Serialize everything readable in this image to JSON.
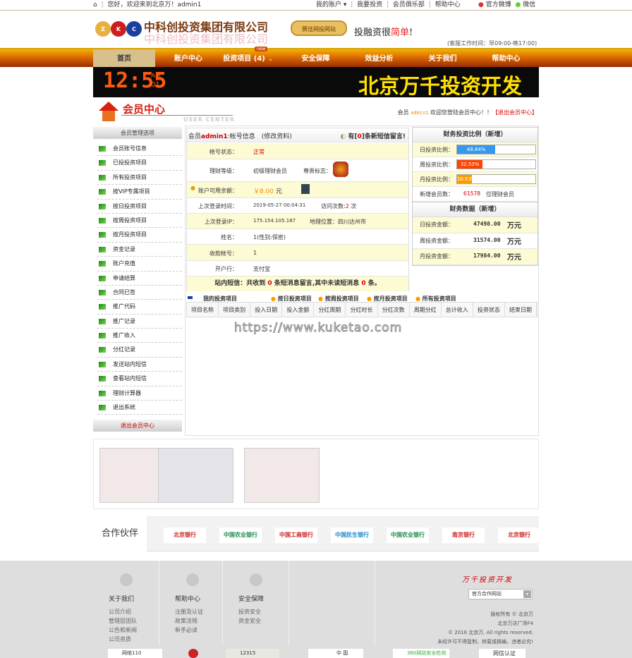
{
  "topbar": {
    "greeting": "您好，欢迎来到北京万！admin1",
    "my_account": "我的账户 ▾",
    "invest": "我要投资",
    "club": "会员俱乐部",
    "help": "帮助中心",
    "weibo": "官方微博",
    "wechat": "微信"
  },
  "header": {
    "company": "中科创投资集团有限公司",
    "badge_text": "赛佳网投网站",
    "slogan": "投融资很",
    "slogan_highlight": "简单",
    "slogan_end": "!",
    "hours": "(客服工作时间：早09:00-晚17:00)",
    "logo_letters": [
      "Z",
      "K",
      "C"
    ]
  },
  "nav": {
    "items": [
      {
        "label": "首页"
      },
      {
        "label": "账户中心"
      },
      {
        "label": "投资项目 (4)"
      },
      {
        "label": "安全保障"
      },
      {
        "label": "效益分析"
      },
      {
        "label": "关于我们"
      },
      {
        "label": "帮助中心"
      }
    ],
    "new_badge": "new"
  },
  "banner": {
    "clock": "12:55",
    "ampm": "AM",
    "sec": "01",
    "text": "北京万千投资开发"
  },
  "member_header": {
    "title": "会员中心",
    "subtitle": "USER CENTER",
    "welcome_pre": "会员",
    "username": "admin1",
    "welcome_post": "欢迎您登陆会员中心！！",
    "logout": "【退出会员中心】"
  },
  "sidebar": {
    "title": "会员管理选项",
    "items": [
      "会员账号信息",
      "已投投资项目",
      "所有投资项目",
      "按VIP专属项目",
      "按日投资项目",
      "按周投资项目",
      "按月投资项目",
      "资金记录",
      "账户充值",
      "申请结算",
      "合同已签",
      "推广代码",
      "推广记录",
      "推广收入",
      "分红记录",
      "发送站内短信",
      "查看站内短信",
      "理财计算器",
      "退出系统"
    ],
    "footer": "退出会员中心"
  },
  "account": {
    "title_pre": "会员",
    "username": "admin1",
    "title_post": ":帐号信息",
    "edit": "(修改资料)",
    "msg_pre": "有[",
    "msg_count": "0",
    "msg_post": "]条新短信留言!",
    "rows": [
      {
        "label": "帐号状态：",
        "value": "正常"
      },
      {
        "label": "理财等级：",
        "value": "初级理财会员",
        "extra_label": "尊贵标志："
      },
      {
        "label": "账户可用余额：",
        "value": "￥8.00",
        "unit": "元"
      },
      {
        "label": "上次登录时间：",
        "value": "2019-05-27 00:04:31",
        "extra_label": "访问次数:",
        "extra_value": "2",
        "extra_unit": "次"
      },
      {
        "label": "上次登录IP：",
        "value": "175.154.105.187",
        "extra_label": "地理位置：四川达州市"
      },
      {
        "label": "姓名：",
        "value": "1(性别:保密)"
      },
      {
        "label": "收款帐号：",
        "value": "1"
      },
      {
        "label": "开户行：",
        "value": "支付宝"
      }
    ],
    "summary_pre": "站内短信：共收到",
    "summary_count": "0",
    "summary_mid": "条短消息留言,其中未读短消息",
    "summary_unread": "0",
    "summary_post": "条。"
  },
  "ratio": {
    "title": "财务投资比例（新增）",
    "rows": [
      {
        "label": "日投资比例：",
        "text": "48.84%",
        "percent": 48.84,
        "color": "#3399ee"
      },
      {
        "label": "周投资比例：",
        "text": "32.53%",
        "percent": 32.53,
        "color": "#ff4400"
      },
      {
        "label": "月投资比例：",
        "text": "18.63%",
        "percent": 18.63,
        "color": "#ff9900"
      }
    ],
    "members_label": "新增会员数：",
    "members_value": "61578",
    "members_unit": "位理财会员"
  },
  "finance": {
    "title": "财务数据（新增）",
    "rows": [
      {
        "label": "日投资金额：",
        "value": "47498.00",
        "unit": "万元"
      },
      {
        "label": "周投资金额：",
        "value": "31574.00",
        "unit": "万元"
      },
      {
        "label": "月投资金额：",
        "value": "17984.00",
        "unit": "万元"
      }
    ]
  },
  "tabs": [
    "我的投资项目",
    "按日投资项目",
    "按周投资项目",
    "按月投资项目",
    "所有投资项目"
  ],
  "table_headers": [
    "项目名称",
    "项目类别",
    "投入日期",
    "投入金额",
    "分红周期",
    "分红时长",
    "分红次数",
    "周期分红",
    "总计收入",
    "投资状态",
    "结束日期"
  ],
  "watermark": "https://www.kuketao.com",
  "partners": {
    "title": "合作伙伴",
    "logos": [
      "北京银行",
      "中国农业银行",
      "中国工商银行",
      "中国民生银行",
      "中国农业银行",
      "南京银行",
      "北京银行"
    ]
  },
  "footer": {
    "cols": [
      {
        "title": "关于我们",
        "links": [
          "公司介绍",
          "管理层团队",
          "公告和新闻",
          "公司资质"
        ]
      },
      {
        "title": "帮助中心",
        "links": [
          "注册及认证",
          "政策法规",
          "新手必读"
        ]
      },
      {
        "title": "安全保障",
        "links": [
          "投资安全",
          "资金安全"
        ]
      }
    ],
    "brand": "万千投资开发",
    "select": "官方合作网站",
    "copyright": [
      "版权所有 © 北京万",
      "北京万达广场F4",
      "© 2016 北京万. All rights reserved.",
      "未经许可不得复制、转载或摘编，违者必究!"
    ],
    "badges": [
      "网络110",
      "",
      "12315",
      "中 国",
      "360网站安全检测",
      "网信认证"
    ]
  }
}
